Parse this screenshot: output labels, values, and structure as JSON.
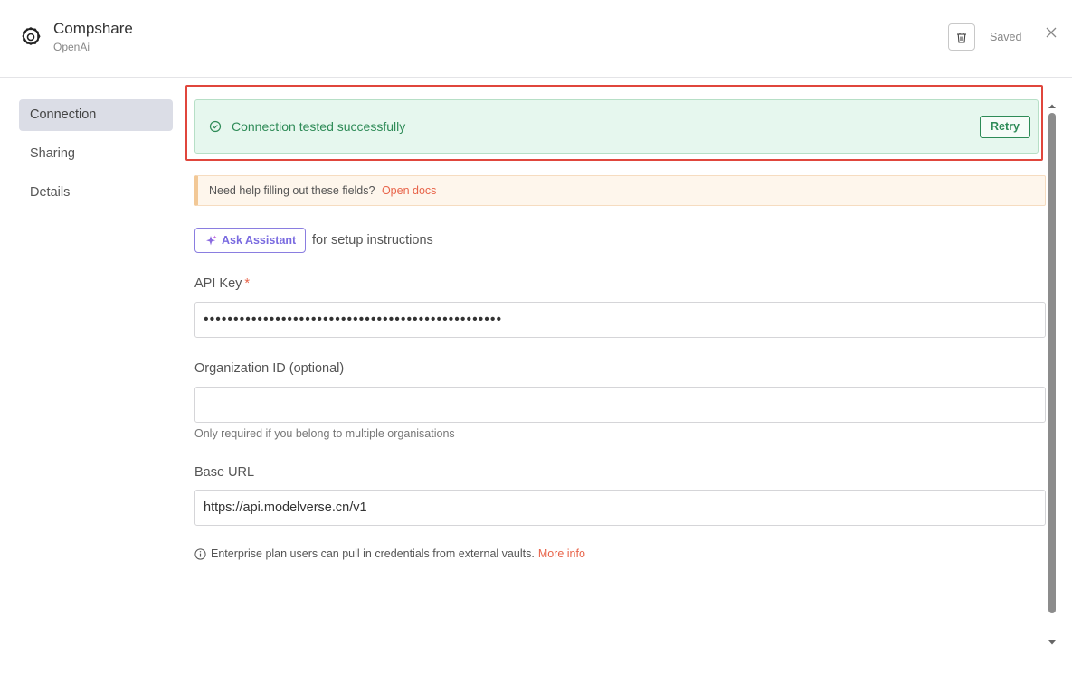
{
  "header": {
    "title": "Compshare",
    "subtitle": "OpenAi",
    "saved_label": "Saved",
    "logo_icon": "openai-logo-icon",
    "delete_icon": "trash-icon",
    "close_icon": "close-icon"
  },
  "sidebar": {
    "items": [
      {
        "label": "Connection",
        "active": true
      },
      {
        "label": "Sharing",
        "active": false
      },
      {
        "label": "Details",
        "active": false
      }
    ]
  },
  "banner": {
    "text": "Connection tested successfully",
    "retry_label": "Retry",
    "icon": "check-circle-icon",
    "color": "#2e8b57"
  },
  "notice": {
    "text": "Need help filling out these fields?",
    "link": "Open docs"
  },
  "assistant": {
    "button_label": "Ask Assistant",
    "suffix": "for setup instructions",
    "icon": "sparkle-icon"
  },
  "fields": {
    "api_key": {
      "label": "API Key",
      "required_mark": "*",
      "value": "••••••••••••••••••••••••••••••••••••••••••••••••••"
    },
    "org_id": {
      "label": "Organization ID (optional)",
      "value": "",
      "hint": "Only required if you belong to multiple organisations"
    },
    "base_url": {
      "label": "Base URL",
      "value": "https://api.modelverse.cn/v1"
    }
  },
  "enterprise": {
    "text": "Enterprise plan users can pull in credentials from external vaults.",
    "link": "More info",
    "icon": "info-icon"
  },
  "colors": {
    "accent_link": "#e8644a",
    "success": "#2e8b57",
    "assistant_purple": "#7a6be0",
    "highlight": "#e0463c"
  }
}
